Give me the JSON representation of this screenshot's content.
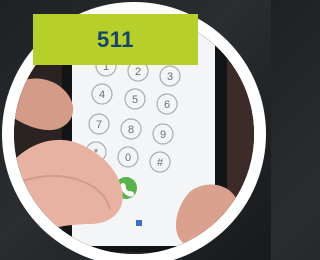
{
  "banner": {
    "title": "511",
    "background_color": "#b6cf2a",
    "text_color": "#15436a"
  },
  "phone": {
    "display_number": "511",
    "keys": [
      "1",
      "2",
      "3",
      "4",
      "5",
      "6",
      "7",
      "8",
      "9",
      "*",
      "0",
      "#"
    ],
    "call_button_color": "#58b44a"
  }
}
